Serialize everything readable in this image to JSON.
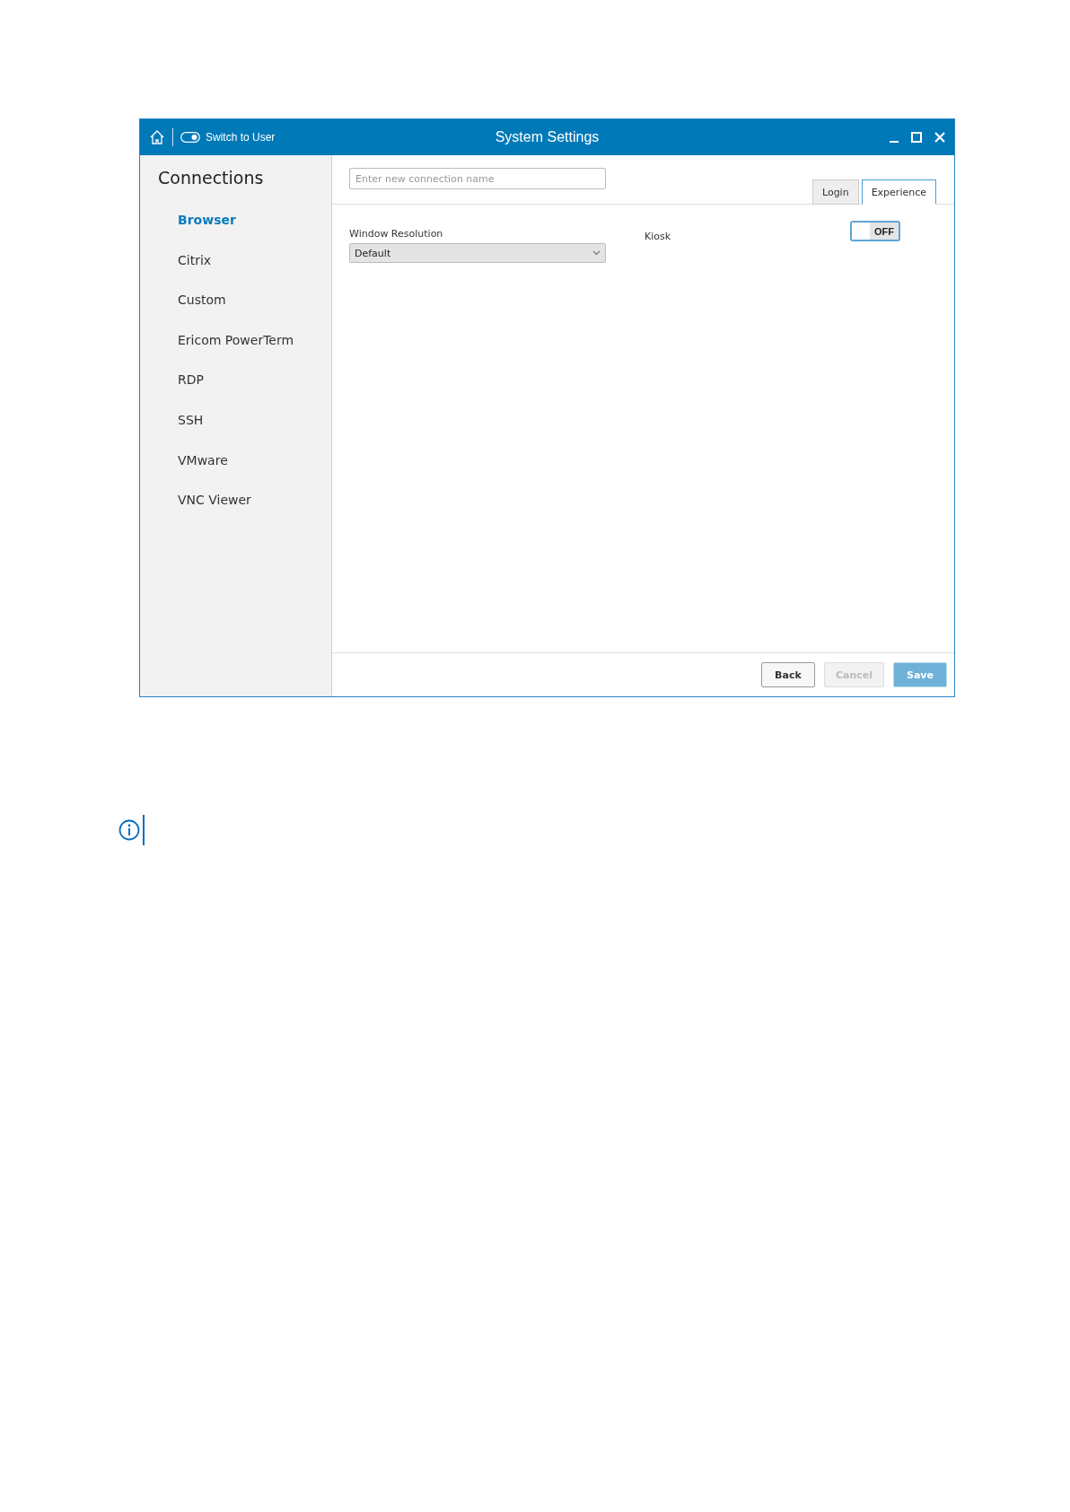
{
  "window": {
    "title": "System Settings",
    "switch_label": "Switch to User"
  },
  "sidebar": {
    "title": "Connections",
    "items": [
      {
        "label": "Browser",
        "selected": true
      },
      {
        "label": "Citrix",
        "selected": false
      },
      {
        "label": "Custom",
        "selected": false
      },
      {
        "label": "Ericom PowerTerm",
        "selected": false
      },
      {
        "label": "RDP",
        "selected": false
      },
      {
        "label": "SSH",
        "selected": false
      },
      {
        "label": "VMware",
        "selected": false
      },
      {
        "label": "VNC Viewer",
        "selected": false
      }
    ]
  },
  "name_field": {
    "placeholder": "Enter new connection name"
  },
  "tabs": [
    {
      "label": "Login",
      "selected": false
    },
    {
      "label": "Experience",
      "selected": true
    }
  ],
  "window_resolution": {
    "label": "Window Resolution",
    "value": "Default"
  },
  "kiosk": {
    "label": "Kiosk",
    "on": false,
    "state_text": "OFF"
  },
  "buttons": [
    {
      "label": "Back",
      "disabled": false,
      "kind": "plain"
    },
    {
      "label": "Cancel",
      "disabled": true,
      "kind": "plain"
    },
    {
      "label": "Save",
      "disabled": true,
      "kind": "primary"
    }
  ]
}
